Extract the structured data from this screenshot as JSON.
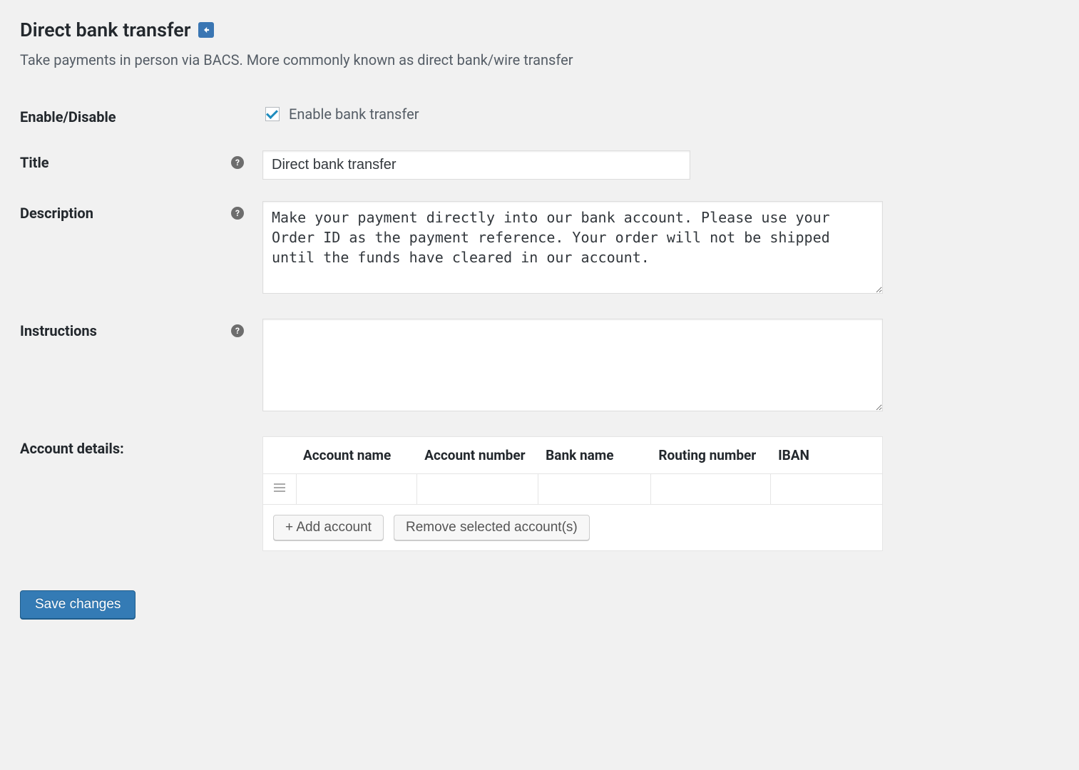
{
  "header": {
    "title": "Direct bank transfer",
    "subtitle": "Take payments in person via BACS. More commonly known as direct bank/wire transfer"
  },
  "fields": {
    "enable_disable": {
      "label": "Enable/Disable",
      "checkbox_label": "Enable bank transfer",
      "checked": true
    },
    "title": {
      "label": "Title",
      "value": "Direct bank transfer"
    },
    "description": {
      "label": "Description",
      "value": "Make your payment directly into our bank account. Please use your Order ID as the payment reference. Your order will not be shipped until the funds have cleared in our account."
    },
    "instructions": {
      "label": "Instructions",
      "value": ""
    },
    "accounts": {
      "label": "Account details:",
      "columns": [
        "Account name",
        "Account number",
        "Bank name",
        "Routing number",
        "IBAN"
      ],
      "rows": [
        {
          "account_name": "",
          "account_number": "",
          "bank_name": "",
          "routing_number": "",
          "iban": ""
        }
      ],
      "add_label": "+ Add account",
      "remove_label": "Remove selected account(s)"
    }
  },
  "actions": {
    "save": "Save changes"
  },
  "help_tip_glyph": "?"
}
